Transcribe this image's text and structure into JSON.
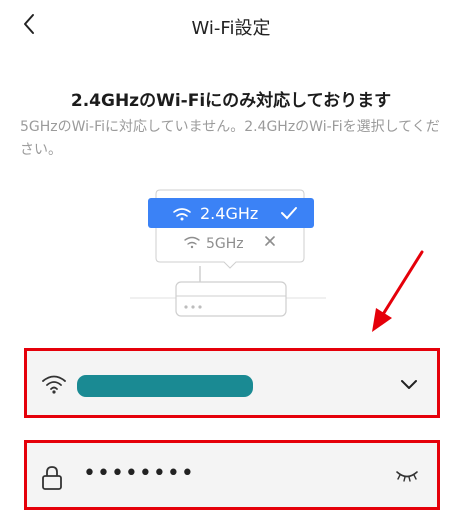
{
  "header": {
    "back_icon": "chevron-left-icon",
    "title": "Wi-Fi設定"
  },
  "main": {
    "headline": "2.4GHzのWi-Fiにのみ対応しております",
    "description": "5GHzのWi-Fiに対応していません。2.4GHzのWi-Fiを選択してください。",
    "illustration": {
      "option_24": "2.4GHz",
      "option_5": "5GHz"
    }
  },
  "form": {
    "ssid_field": {
      "icon": "wifi-icon",
      "value_masked": true,
      "dropdown_icon": "chevron-down-icon"
    },
    "password_field": {
      "icon": "lock-icon",
      "value": "••••••••",
      "toggle_icon": "eye-closed-icon"
    }
  },
  "colors": {
    "accent_blue": "#3b82f6",
    "highlight_red": "#e5000a",
    "mask_teal": "#1a8a93"
  }
}
